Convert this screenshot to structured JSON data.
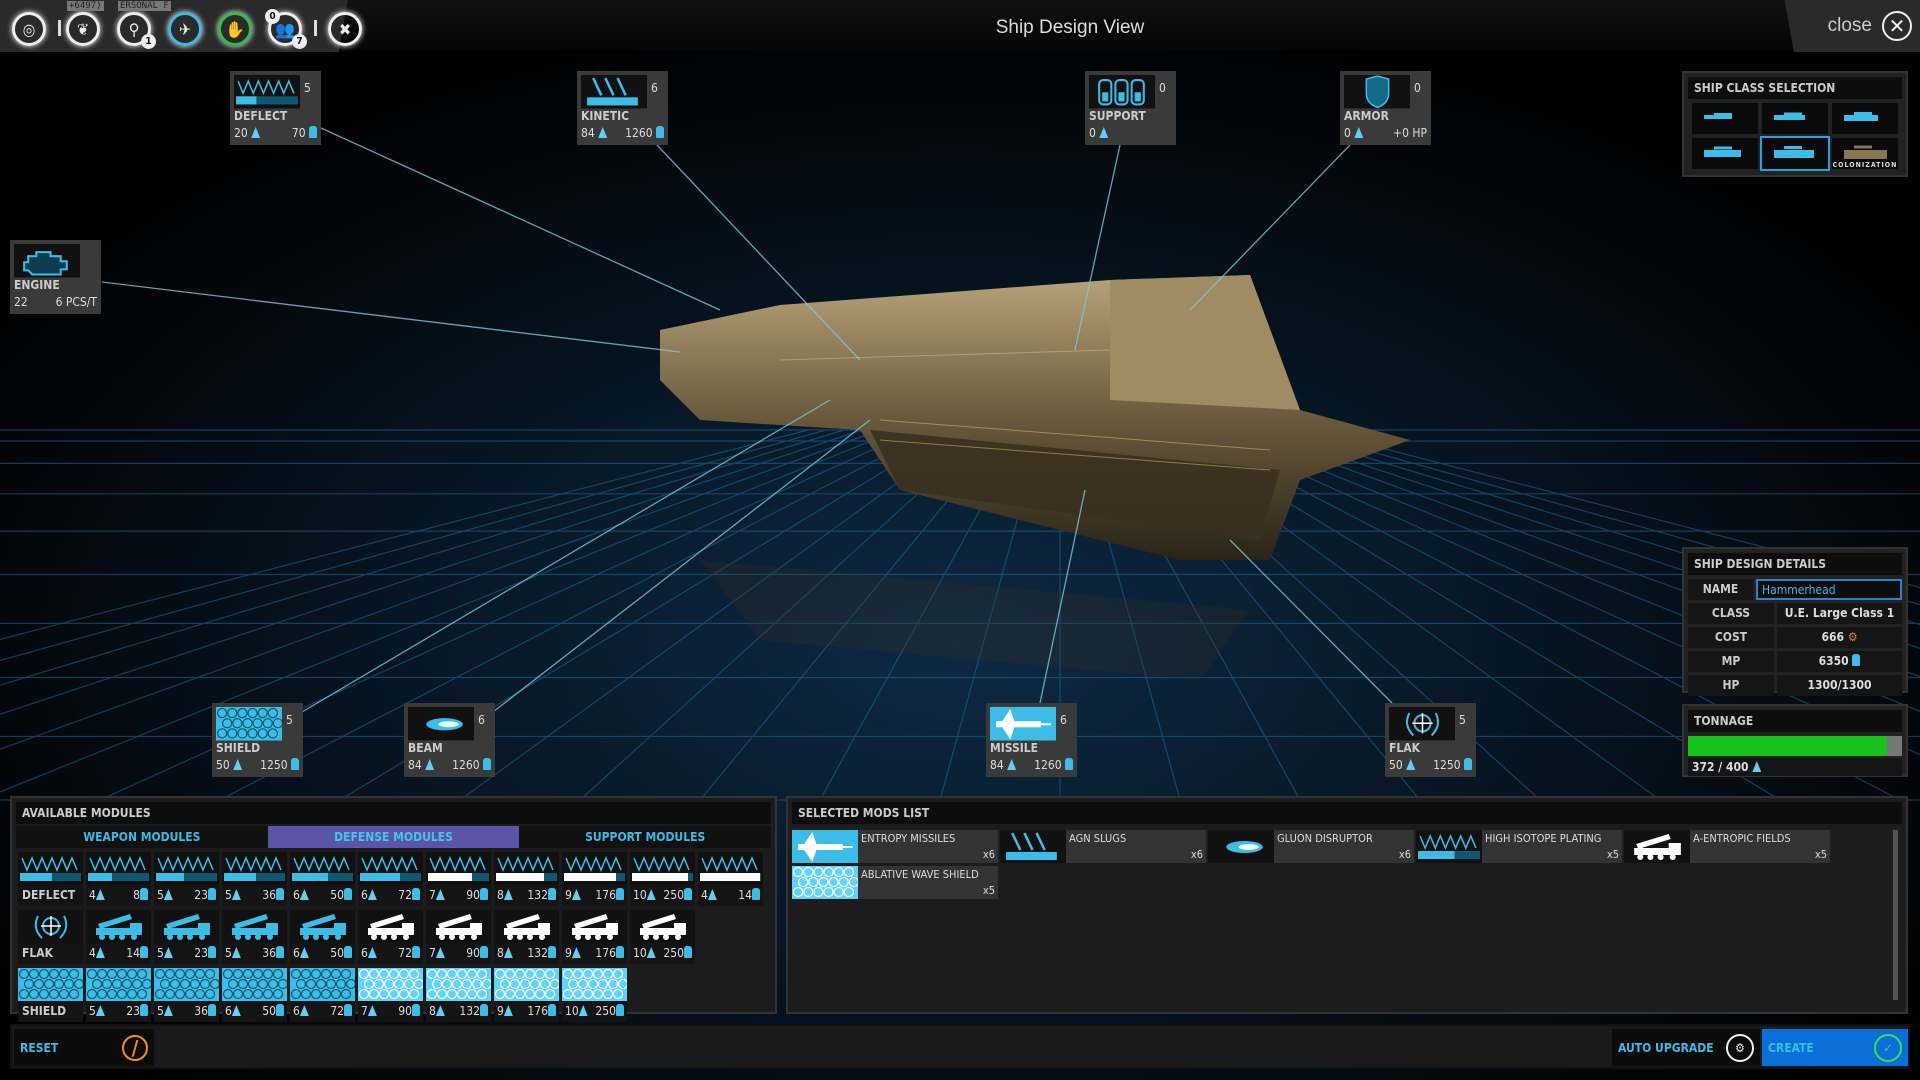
{
  "window": {
    "title": "Ship Design View",
    "close_label": "close"
  },
  "top_icons": [
    {
      "name": "galaxy-icon"
    },
    {
      "name": "empire-laurel-icon",
      "overlay_text": "+6497)"
    },
    {
      "name": "research-microscope-icon",
      "overlay_text": "ERSONAL F",
      "badge": "1"
    },
    {
      "name": "ship-icon"
    },
    {
      "name": "diplomacy-handshake-icon"
    },
    {
      "name": "population-icon",
      "badge_top": "0",
      "badge": "7"
    },
    {
      "name": "settings-tools-icon"
    }
  ],
  "slots": {
    "deflect": {
      "label": "DEFLECT",
      "count": "5",
      "tonnage": "20",
      "mp": "70"
    },
    "kinetic": {
      "label": "KINETIC",
      "count": "6",
      "tonnage": "84",
      "mp": "1260"
    },
    "support": {
      "label": "SUPPORT",
      "count": "0",
      "tonnage": "0"
    },
    "armor": {
      "label": "ARMOR",
      "count": "0",
      "tonnage": "0",
      "hp": "+0 HP"
    },
    "engine": {
      "label": "ENGINE",
      "tonnage": "22",
      "rate": "6 PCS/T"
    },
    "shield": {
      "label": "SHIELD",
      "count": "5",
      "tonnage": "50",
      "mp": "1250"
    },
    "beam": {
      "label": "BEAM",
      "count": "6",
      "tonnage": "84",
      "mp": "1260"
    },
    "missile": {
      "label": "MISSILE",
      "count": "6",
      "tonnage": "84",
      "mp": "1260"
    },
    "flak": {
      "label": "FLAK",
      "count": "5",
      "tonnage": "50",
      "mp": "1250"
    }
  },
  "ship_class": {
    "title": "SHIP CLASS SELECTION",
    "options": [
      "",
      "",
      "",
      "",
      "",
      "COLONIZATION"
    ],
    "selected_index": 4
  },
  "details": {
    "title": "SHIP DESIGN DETAILS",
    "name_label": "NAME",
    "name_value": "Hammerhead",
    "class_label": "CLASS",
    "class_value": "U.E. Large Class 1",
    "cost_label": "COST",
    "cost_value": "666",
    "mp_label": "MP",
    "mp_value": "6350",
    "hp_label": "HP",
    "hp_value": "1300/1300"
  },
  "tonnage": {
    "title": "TONNAGE",
    "used": 372,
    "max": 400,
    "text": "372 / 400",
    "bar_color": "#19c21c"
  },
  "available": {
    "title": "AVAILABLE MODULES",
    "tabs": [
      "WEAPON MODULES",
      "DEFENSE MODULES",
      "SUPPORT MODULES"
    ],
    "active_tab": 1,
    "rows": [
      {
        "label": "DEFLECT",
        "kind": "deflect",
        "items": [
          [
            "4",
            "8"
          ],
          [
            "5",
            "23"
          ],
          [
            "5",
            "36"
          ],
          [
            "6",
            "50"
          ],
          [
            "6",
            "72"
          ],
          [
            "7",
            "90"
          ],
          [
            "8",
            "132"
          ],
          [
            "9",
            "176"
          ],
          [
            "10",
            "250"
          ],
          [
            "4",
            "14"
          ]
        ]
      },
      {
        "label": "FLAK",
        "kind": "flak",
        "items": [
          [
            "4",
            "14"
          ],
          [
            "5",
            "23"
          ],
          [
            "5",
            "36"
          ],
          [
            "6",
            "50"
          ],
          [
            "6",
            "72"
          ],
          [
            "7",
            "90"
          ],
          [
            "8",
            "132"
          ],
          [
            "9",
            "176"
          ],
          [
            "10",
            "250"
          ]
        ]
      },
      {
        "label": "SHIELD",
        "kind": "shield",
        "items": [
          [
            "5",
            "23"
          ],
          [
            "5",
            "36"
          ],
          [
            "6",
            "50"
          ],
          [
            "6",
            "72"
          ],
          [
            "7",
            "90"
          ],
          [
            "8",
            "132"
          ],
          [
            "9",
            "176"
          ],
          [
            "10",
            "250"
          ]
        ]
      }
    ]
  },
  "selected": {
    "title": "SELECTED MODS LIST",
    "items": [
      {
        "name": "ENTROPY MISSILES",
        "qty": "x6",
        "kind": "missile"
      },
      {
        "name": "AGN SLUGS",
        "qty": "x6",
        "kind": "kinetic"
      },
      {
        "name": "GLUON DISRUPTOR",
        "qty": "x6",
        "kind": "beam"
      },
      {
        "name": "HIGH ISOTOPE PLATING",
        "qty": "x5",
        "kind": "deflect"
      },
      {
        "name": "A-ENTROPIC FIELDS",
        "qty": "x5",
        "kind": "flak"
      },
      {
        "name": "ABLATIVE WAVE SHIELD",
        "qty": "x5",
        "kind": "shield"
      }
    ]
  },
  "footer": {
    "reset": "RESET",
    "auto_upgrade": "AUTO UPGRADE",
    "create": "CREATE"
  },
  "colors": {
    "accent": "#3cbde8",
    "active_tab": "#5b55a8",
    "create": "#0a6fd6",
    "reset_icon": "#f0901a",
    "create_icon": "#3ee04a",
    "cost_icon": "#f07a20"
  }
}
